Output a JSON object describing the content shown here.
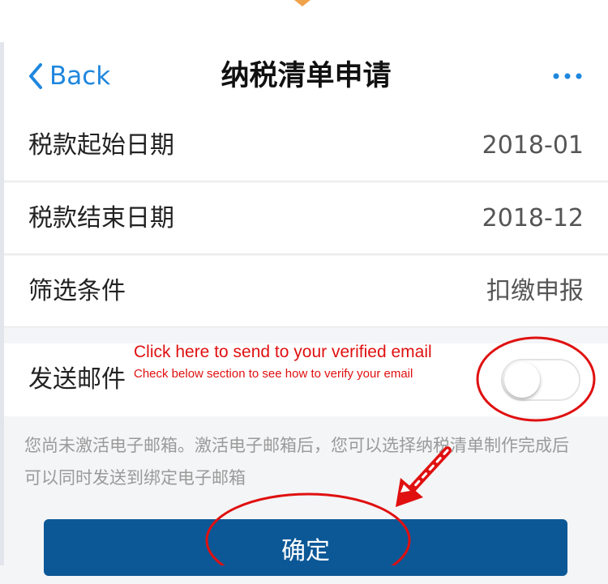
{
  "navbar": {
    "back_label": "Back",
    "title": "纳税清单申请",
    "more_icon": "ellipsis-icon",
    "accent_color": "#1e87de"
  },
  "form": {
    "rows": [
      {
        "label": "税款起始日期",
        "value": "2018-01"
      },
      {
        "label": "税款结束日期",
        "value": "2018-12"
      },
      {
        "label": "筛选条件",
        "value": "扣缴申报"
      }
    ],
    "email": {
      "label": "发送邮件",
      "toggle_on": false
    },
    "note": "您尚未激活电子邮箱。激活电子邮箱后，您可以选择纳税清单制作完成后可以同时发送到绑定电子邮箱"
  },
  "confirm_button": {
    "label": "确定",
    "color": "#0c5897"
  },
  "annotations": {
    "primary": "Click here to send to your verified email",
    "secondary": "Check below section to see how to verify your email",
    "color": "#e01010"
  }
}
